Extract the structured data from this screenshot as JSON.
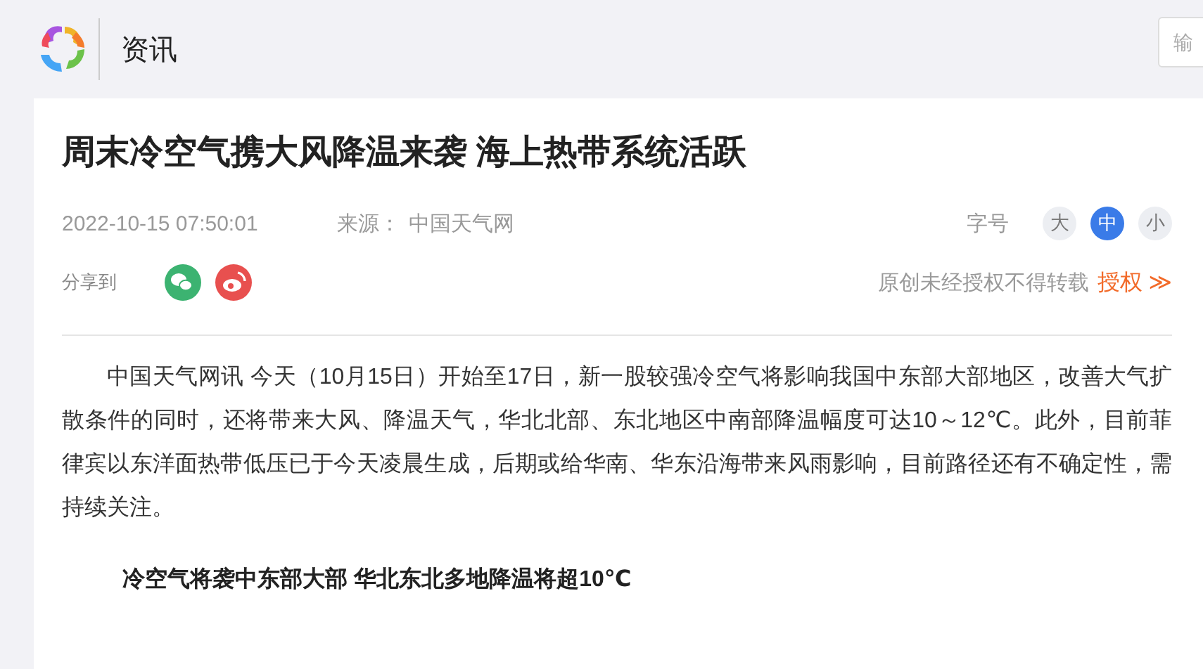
{
  "header": {
    "section": "资讯",
    "search": {
      "placeholder": "输"
    }
  },
  "article": {
    "title": "周末冷空气携大风降温来袭 海上热带系统活跃",
    "datetime": "2022-10-15 07:50:01",
    "source_label": "来源：",
    "source": "中国天气网",
    "font_size_label": "字号",
    "font_sizes": [
      {
        "label": "大",
        "selected": false
      },
      {
        "label": "中",
        "selected": true
      },
      {
        "label": "小",
        "selected": false
      }
    ],
    "share_label": "分享到",
    "share": [
      {
        "kind": "wechat"
      },
      {
        "kind": "weibo"
      }
    ],
    "copyright": "原创未经授权不得转载",
    "license_link": "授权",
    "license_arrow": "≫",
    "paragraphs": [
      {
        "kind": "text",
        "text": "中国天气网讯 今天（10月15日）开始至17日，新一股较强冷空气将影响我国中东部大部地区，改善大气扩散条件的同时，还将带来大风、降温天气，华北北部、东北地区中南部降温幅度可达10～12℃。此外，目前菲律宾以东洋面热带低压已于今天凌晨生成，后期或给华南、华东沿海带来风雨影响，目前路径还有不确定性，需持续关注。"
      },
      {
        "kind": "heading",
        "text": "冷空气将袭中东部大部 华北东北多地降温将超10℃"
      }
    ]
  }
}
